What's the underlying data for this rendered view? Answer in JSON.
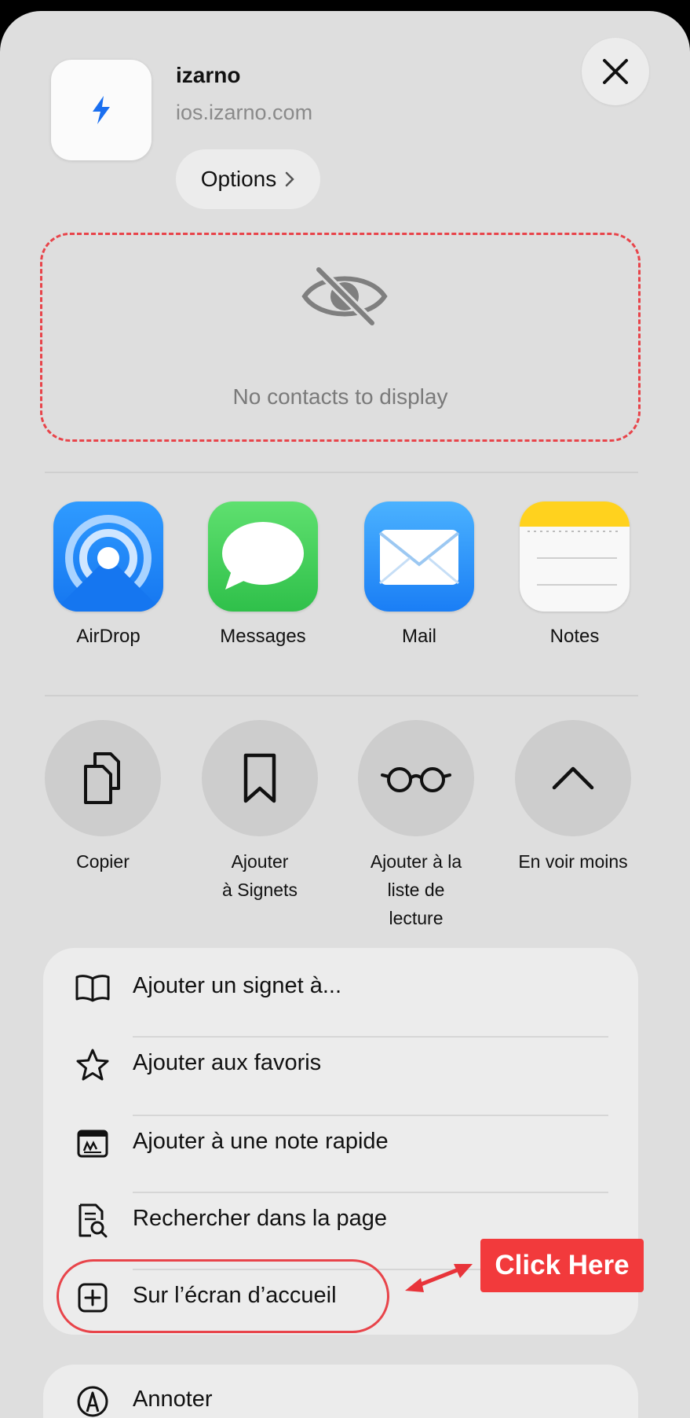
{
  "header": {
    "app_name": "izarno",
    "url": "ios.izarno.com",
    "options_label": "Options",
    "icon": "lightning-bolt-icon",
    "accent": "#1a6ff0"
  },
  "contacts": {
    "empty_text": "No contacts to display"
  },
  "share_apps": [
    {
      "label": "AirDrop",
      "icon": "airdrop-icon"
    },
    {
      "label": "Messages",
      "icon": "messages-icon"
    },
    {
      "label": "Mail",
      "icon": "mail-icon"
    },
    {
      "label": "Notes",
      "icon": "notes-icon"
    }
  ],
  "actions": [
    {
      "label": "Copier",
      "icon": "copy-icon"
    },
    {
      "label": "Ajouter\nà Signets",
      "icon": "bookmark-icon"
    },
    {
      "label": "Ajouter à la\nliste de\nlecture",
      "icon": "glasses-icon"
    },
    {
      "label": "En voir moins",
      "icon": "chevron-up-icon"
    }
  ],
  "menu": [
    {
      "label": "Ajouter un signet à...",
      "icon": "book-icon"
    },
    {
      "label": "Ajouter aux favoris",
      "icon": "star-icon"
    },
    {
      "label": "Ajouter à une note rapide",
      "icon": "quick-note-icon"
    },
    {
      "label": "Rechercher dans la page",
      "icon": "find-in-page-icon"
    },
    {
      "label": "Sur l’écran d’accueil",
      "icon": "plus-square-icon"
    }
  ],
  "menu2": [
    {
      "label": "Annoter",
      "icon": "markup-icon"
    }
  ],
  "annotation": {
    "label": "Click Here",
    "color": "#f23a3c"
  }
}
